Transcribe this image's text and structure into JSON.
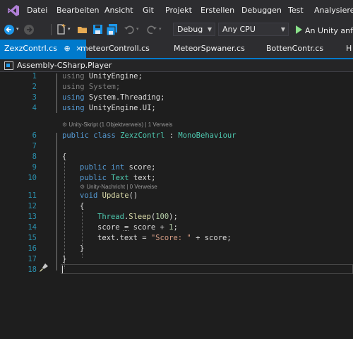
{
  "menu": [
    "Datei",
    "Bearbeiten",
    "Ansicht",
    "Git",
    "Projekt",
    "Erstellen",
    "Debuggen",
    "Test",
    "Analysieren"
  ],
  "toolbar": {
    "config": "Debug",
    "platform": "Any CPU",
    "run_label": "An Unity anfüg"
  },
  "tabs": [
    {
      "label": "ZexzContrl.cs",
      "pin": "⊕",
      "close": "×"
    },
    {
      "label": "meteorControll.cs"
    },
    {
      "label": "MeteorSpwaner.cs"
    },
    {
      "label": "BottenContr.cs"
    },
    {
      "label": "H"
    }
  ],
  "navbar": {
    "project": "Assembly-CSharp.Player"
  },
  "code": {
    "line_numbers": [
      "1",
      "2",
      "3",
      "4",
      "6",
      "7",
      "8",
      "9",
      "10",
      "11",
      "12",
      "13",
      "14",
      "15",
      "16",
      "17",
      "18"
    ],
    "lines": {
      "l1": {
        "kw": "using",
        "rest": " UnityEngine;"
      },
      "l2": {
        "kw": "using",
        "rest": " System;"
      },
      "l3": {
        "kw": "using",
        "rest": " System.Threading;"
      },
      "l4": {
        "kw": "using",
        "rest": " UnityEngine.UI;"
      },
      "l6": {
        "kw1": "public",
        "kw2": "class",
        "name": "ZexzContrl",
        "sep": " : ",
        "base": "MonoBehaviour"
      },
      "l8": {
        "text": "{"
      },
      "l9": {
        "kw1": "public",
        "kw2": "int",
        "rest": " score;"
      },
      "l10": {
        "kw1": "public",
        "type": "Text",
        "rest": " text;"
      },
      "l11": {
        "kw": "void",
        "fn": "Update",
        "rest": "()"
      },
      "l12": {
        "text": "{"
      },
      "l13": {
        "type": "Thread",
        "dot": ".",
        "fn": "Sleep",
        "open": "(",
        "num": "100",
        "close": ");"
      },
      "l14": {
        "a": "score ",
        "op": "=",
        "b": " score + ",
        "num": "1",
        "end": ";"
      },
      "l15": {
        "a": "text.text = ",
        "str": "\"Score: \"",
        "b": " + score;"
      },
      "l16": {
        "text": "}"
      },
      "l17": {
        "text": "}"
      }
    },
    "hints": {
      "class_hint": "Unity-Skript (1 Objektverweis) | 1 Verweis",
      "method_hint": "Unity-Nachricht | 0 Verweise"
    }
  },
  "colors": {
    "accent": "#007acc",
    "keyword": "#569cd6",
    "type": "#4ec9b0",
    "method": "#dcdcaa",
    "number": "#b5cea8",
    "string": "#d69d85",
    "line_number": "#2b91af"
  }
}
